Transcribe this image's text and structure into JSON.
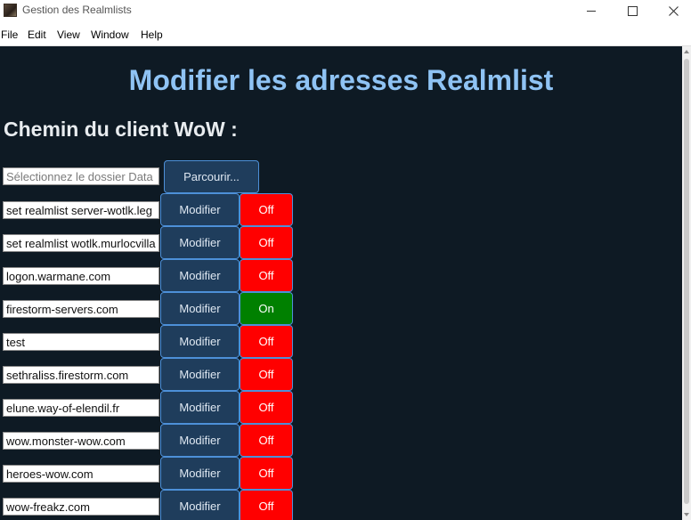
{
  "window": {
    "title": "Gestion des Realmlists",
    "controls": [
      "minimize-icon",
      "maximize-icon",
      "close-icon"
    ]
  },
  "menu": [
    "File",
    "Edit",
    "View",
    "Window",
    "Help"
  ],
  "main": {
    "heading": "Modifier les adresses Realmlist",
    "client_label": "Chemin du client WoW :",
    "path_placeholder": "Sélectionnez le dossier Data",
    "browse_label": "Parcourir...",
    "modify_label": "Modifier",
    "rows": [
      {
        "value": "set realmlist server-wotlk.leg",
        "state": "Off"
      },
      {
        "value": "set realmlist wotlk.murlocvilla",
        "state": "Off"
      },
      {
        "value": "logon.warmane.com",
        "state": "Off"
      },
      {
        "value": "firestorm-servers.com",
        "state": "On"
      },
      {
        "value": "test",
        "state": "Off"
      },
      {
        "value": "sethraliss.firestorm.com",
        "state": "Off"
      },
      {
        "value": "elune.way-of-elendil.fr",
        "state": "Off"
      },
      {
        "value": "wow.monster-wow.com",
        "state": "Off"
      },
      {
        "value": "heroes-wow.com",
        "state": "Off"
      },
      {
        "value": "wow-freakz.com",
        "state": "Off"
      }
    ]
  },
  "colors": {
    "background": "#0e1a24",
    "heading": "#8fc3f4",
    "button": "#1f3d5c",
    "button_border": "#4d90d8",
    "off": "#ff0000",
    "on": "#008000"
  }
}
